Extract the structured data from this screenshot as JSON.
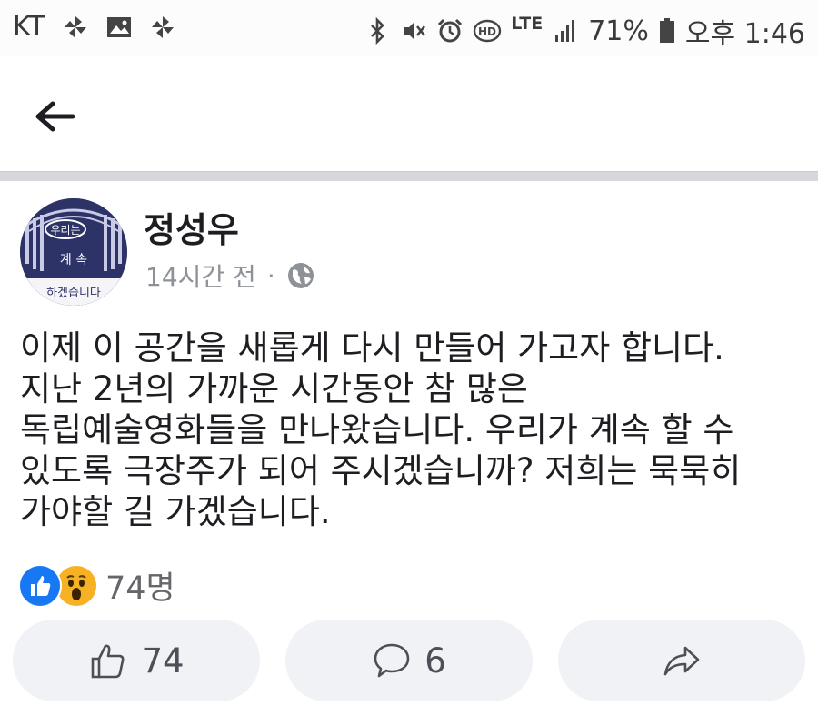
{
  "status_bar": {
    "carrier": "KT",
    "network": "LTE",
    "battery": "71%",
    "time": "오후 1:46",
    "icons": [
      "pinwheel-icon",
      "image-icon",
      "pinwheel-icon",
      "bluetooth-icon",
      "mute-icon",
      "alarm-icon",
      "hd-icon",
      "lte-icon",
      "signal-icon",
      "battery-icon"
    ]
  },
  "nav": {
    "back_icon": "arrow-left-icon"
  },
  "post": {
    "author": "정성우",
    "time_ago": "14시간 전",
    "separator": "·",
    "privacy_icon": "globe-icon",
    "avatar": {
      "line1": "우리는",
      "line2": "계 속",
      "line3": "하겠습니다"
    },
    "lines": [
      "이제 이 공간을 새롭게 다시 만들어 가고자 합니다.",
      "지난 2년의 가까운 시간동안 참 많은",
      "독립예술영화들을 만나왔습니다. 우리가 계속 할 수",
      "있도록 극장주가 되어 주시겠습니까? 저희는 묵묵히",
      "가야할 길 가겠습니다."
    ]
  },
  "reactions": {
    "types": [
      "like",
      "wow"
    ],
    "count": "74명"
  },
  "actions": {
    "like": {
      "icon": "thumbs-up-icon",
      "count": "74"
    },
    "comment": {
      "icon": "comment-icon",
      "count": "6"
    },
    "share": {
      "icon": "share-icon"
    }
  },
  "colors": {
    "like_blue": "#1877f2",
    "wow_yellow": "#f7b125",
    "button_bg": "#f0f2f5",
    "avatar_navy": "#2d3366"
  }
}
